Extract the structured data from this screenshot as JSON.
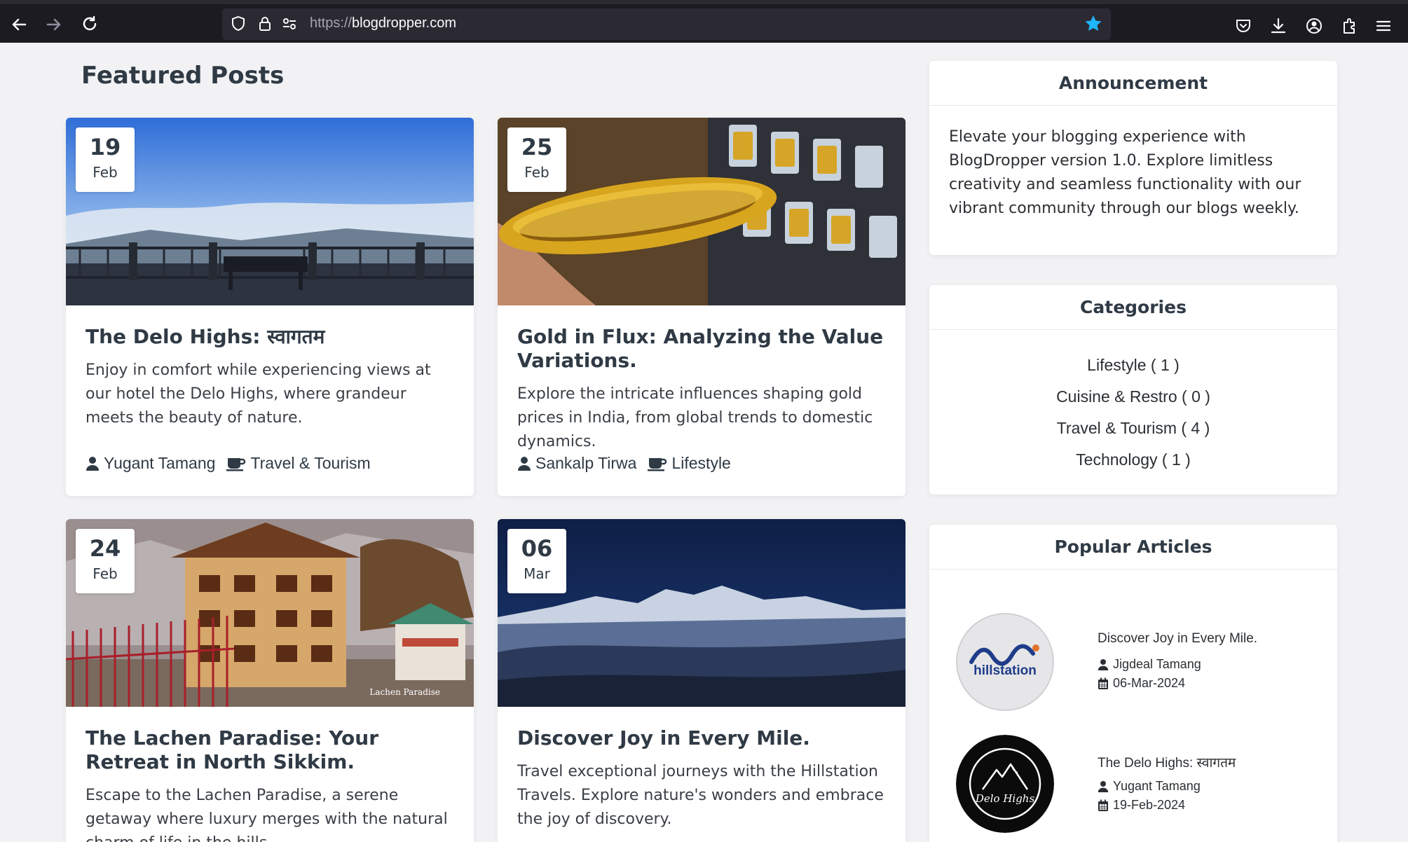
{
  "browser": {
    "url_scheme": "https://",
    "url_host": "blogdropper.com"
  },
  "featured": {
    "title": "Featured Posts",
    "posts": [
      {
        "day": "19",
        "month": "Feb",
        "title": "The Delo Highs: स्वागतम",
        "excerpt": "Enjoy in comfort while experiencing views at our hotel the Delo Highs, where grandeur meets the beauty of nature.",
        "author": "Yugant Tamang",
        "category": "Travel & Tourism"
      },
      {
        "day": "25",
        "month": "Feb",
        "title": "Gold in Flux: Analyzing the Value Variations.",
        "excerpt": "Explore the intricate influences shaping gold prices in India, from global trends to domestic dynamics.",
        "author": "Sankalp Tirwa",
        "category": "Lifestyle"
      },
      {
        "day": "24",
        "month": "Feb",
        "title": "The Lachen Paradise: Your Retreat in North Sikkim.",
        "excerpt": "Escape to the Lachen Paradise, a serene getaway where luxury merges with the natural charm of life in the hills.",
        "image_caption": "Lachen Paradise"
      },
      {
        "day": "06",
        "month": "Mar",
        "title": "Discover Joy in Every Mile.",
        "excerpt": "Travel exceptional journeys with the Hillstation Travels. Explore nature's wonders and embrace the joy of discovery."
      }
    ]
  },
  "announcement": {
    "title": "Announcement",
    "text": "Elevate your blogging experience with BlogDropper version 1.0. Explore limitless creativity and seamless functionality with our vibrant community through our blogs weekly."
  },
  "categories": {
    "title": "Categories",
    "items": [
      "Lifestyle ( 1 )",
      "Cuisine & Restro ( 0 )",
      "Travel & Tourism ( 4 )",
      "Technology ( 1 )"
    ]
  },
  "popular": {
    "title": "Popular Articles",
    "items": [
      {
        "title": "Discover Joy in Every Mile.",
        "author": "Jigdeal Tamang",
        "date": "06-Mar-2024",
        "logo_text": "hillstation"
      },
      {
        "title": "The Delo Highs: स्वागतम",
        "author": "Yugant Tamang",
        "date": "19-Feb-2024",
        "logo_text": "Delo Highs"
      }
    ]
  }
}
